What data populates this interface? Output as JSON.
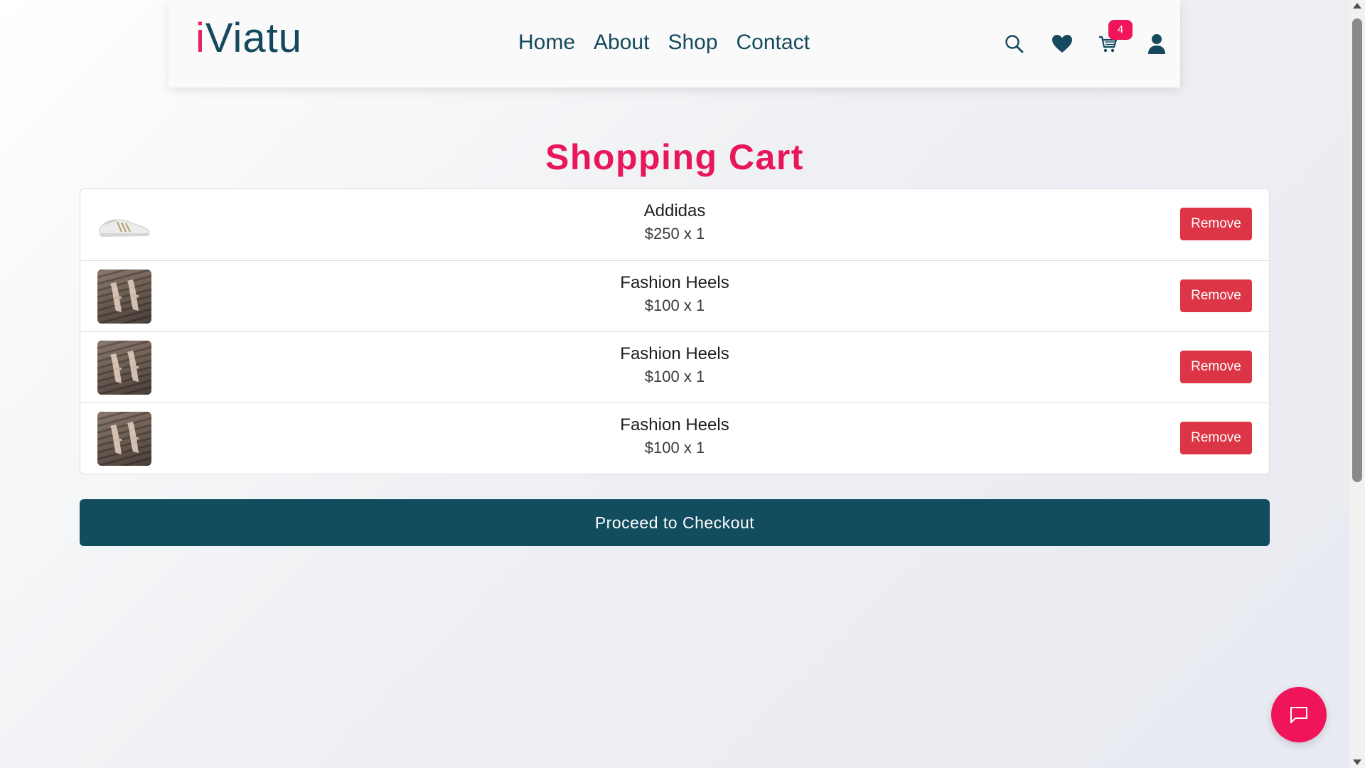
{
  "header": {
    "logo_i": "i",
    "logo_rest": "Viatu",
    "nav": [
      "Home",
      "About",
      "Shop",
      "Contact"
    ],
    "icons": [
      "search-icon",
      "heart-icon",
      "cart-icon",
      "user-icon"
    ],
    "cart_count": "4"
  },
  "main": {
    "title": "Shopping Cart",
    "items": [
      {
        "name": "Addidas",
        "price": "$250 x 1",
        "remove_label": "Remove"
      },
      {
        "name": "Fashion Heels",
        "price": "$100 x 1",
        "remove_label": "Remove"
      },
      {
        "name": "Fashion Heels",
        "price": "$100 x 1",
        "remove_label": "Remove"
      },
      {
        "name": "Fashion Heels",
        "price": "$100 x 1",
        "remove_label": "Remove"
      }
    ],
    "checkout_label": "Proceed to Checkout"
  },
  "colors": {
    "brand_teal": "#124c5f",
    "accent_pink": "#f0145a",
    "remove_red": "#dc3545"
  },
  "chat": {
    "icon": "chat-bubble-icon"
  }
}
